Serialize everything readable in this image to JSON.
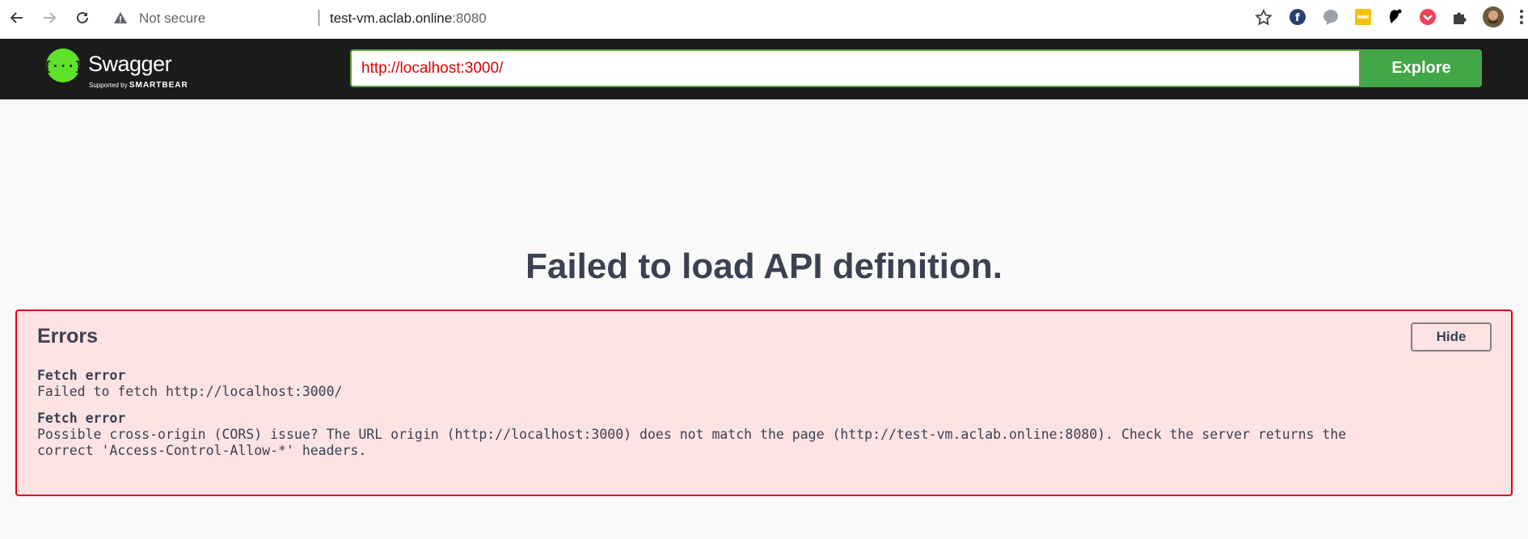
{
  "browser": {
    "security_label": "Not secure",
    "url_host": "test-vm.aclab.online",
    "url_port": ":8080",
    "icons": [
      "back-icon",
      "forward-icon",
      "reload-icon",
      "warning-icon",
      "star-icon",
      "fedora-extension-icon",
      "speech-bubble-extension-icon",
      "yellow-extension-icon",
      "gnome-extension-icon",
      "pocket-extension-icon",
      "puzzle-extensions-icon",
      "profile-avatar",
      "kebab-menu-icon"
    ]
  },
  "topbar": {
    "logo_name": "Swagger",
    "logo_supported": "Supported by",
    "logo_brand": "SMARTBEAR",
    "url_value": "http://localhost:3000/",
    "explore_label": "Explore"
  },
  "main": {
    "title": "Failed to load API definition."
  },
  "errors": {
    "heading": "Errors",
    "hide_label": "Hide",
    "items": [
      {
        "title": "Fetch error",
        "message": "Failed to fetch http://localhost:3000/"
      },
      {
        "title": "Fetch error",
        "message": "Possible cross-origin (CORS) issue? The URL origin (http://localhost:3000) does not match the page (http://test-vm.aclab.online:8080). Check the server returns the\ncorrect 'Access-Control-Allow-*' headers."
      }
    ]
  },
  "colors": {
    "topbar_bg": "#1b1b1b",
    "explore_green": "#41a747",
    "url_text_red": "#e20000",
    "error_border": "#e2001a",
    "error_bg": "#fde3e4",
    "heading_text": "#3b4151"
  }
}
